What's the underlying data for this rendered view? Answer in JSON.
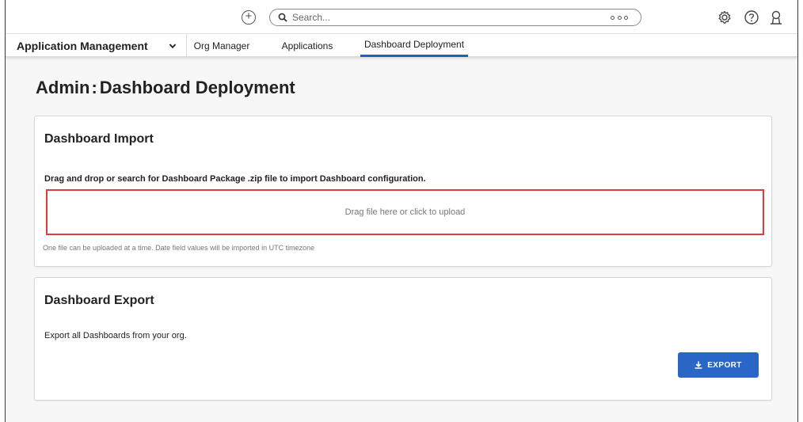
{
  "search": {
    "placeholder": "Search..."
  },
  "nav": {
    "app_menu": "Application Management",
    "tabs": [
      {
        "label": "Org Manager"
      },
      {
        "label": "Applications"
      },
      {
        "label": "Dashboard Deployment",
        "active": true
      }
    ]
  },
  "page": {
    "title_prefix": "Admin",
    "title_sep": ":",
    "title_main": "Dashboard Deployment"
  },
  "import": {
    "title": "Dashboard Import",
    "instruction": "Drag and drop or search for Dashboard Package .zip file to import Dashboard configuration.",
    "dropzone_text": "Drag file here or click to upload",
    "helper": "One file can be uploaded at a time. Date field values will be imported in UTC timezone"
  },
  "export": {
    "title": "Dashboard Export",
    "description": "Export all Dashboards from your org.",
    "button_label": "EXPORT"
  },
  "colors": {
    "accent": "#2a66c6",
    "highlight": "#e0393e",
    "tab_underline": "#1e5fbf"
  }
}
